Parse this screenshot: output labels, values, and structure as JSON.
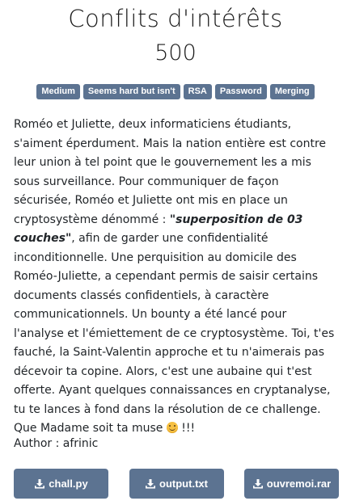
{
  "challenge": {
    "title": "Conflits d'intérêts",
    "points": "500"
  },
  "tags": [
    "Medium",
    "Seems hard but isn't",
    "RSA",
    "Password",
    "Merging"
  ],
  "description": {
    "part1": "Roméo et Juliette, deux informaticiens étudiants, s'aiment éperdument. Mais la nation entière est contre leur union à tel point que le gouvernement les a mis sous surveillance. Pour communiquer de façon sécurisée, Roméo et Juliette ont mis en place un cryptosystème dénommé : ",
    "emphasis": "\"superposition de 03 couches\"",
    "part2": ", afin de garder une confidentialité inconditionnelle. Une perquisition au domicile des Roméo-Juliette, a cependant permis de saisir certains documents classés confidentiels, à caractère communicationnels. Un bounty a été lancé pour l'analyse et l'émiettement de ce cryptosystème. Toi, t'es fauché, la Saint-Valentin approche et tu n'aimerais pas décevoir ta copine. Alors, c'est une aubaine qui t'est offerte. Ayant quelques connaissances en cryptanalyse, tu te lances à fond dans la résolution de ce challenge.",
    "closing_before": "Que Madame soit ta muse ",
    "closing_after": " !!!",
    "emoji": "smiling-face-icon"
  },
  "author": "Author : afrinic",
  "files": [
    {
      "label": "chall.py",
      "icon": "download-icon"
    },
    {
      "label": "output.txt",
      "icon": "download-icon"
    },
    {
      "label": "ouvremoi.rar",
      "icon": "download-icon"
    }
  ],
  "colors": {
    "accent": "#5c7391",
    "text": "#212529",
    "background": "#ffffff"
  }
}
